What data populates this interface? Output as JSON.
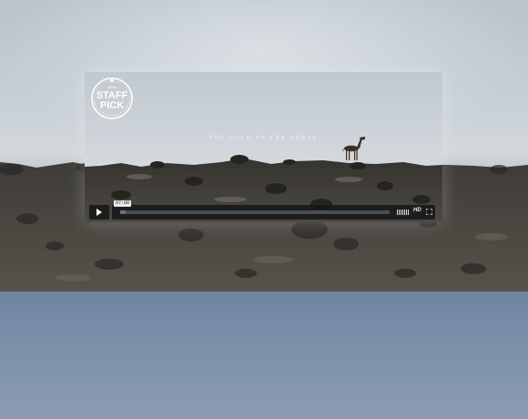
{
  "video": {
    "title": "THE GOLD OF THE ANDES",
    "badge": {
      "top_text": "vimeo",
      "line1": "STAFF",
      "line2": "PICK"
    }
  },
  "player": {
    "timecode": "07:00",
    "progress_fraction": 0,
    "loaded_fraction": 0.02,
    "hd_label": "HD",
    "play_icon": "play-icon",
    "volume_icon": "volume-icon",
    "fullscreen_icon": "fullscreen-icon"
  },
  "colors": {
    "control_bg": "#141616",
    "sky": "#c7cfd6",
    "lower_panel": "#7c90aa"
  }
}
